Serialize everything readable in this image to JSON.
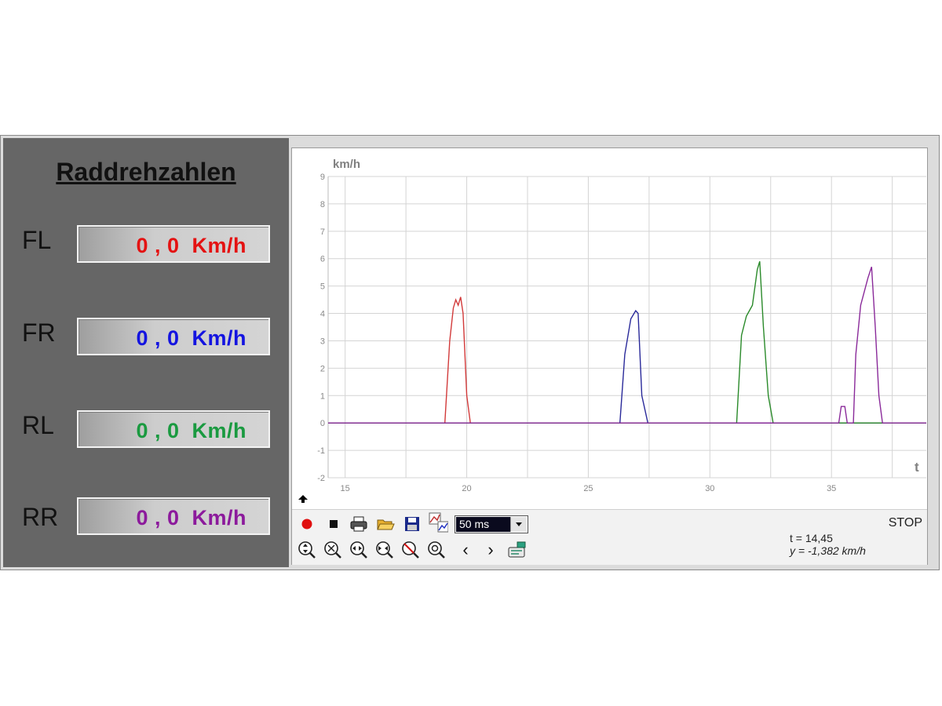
{
  "panel": {
    "title": "Raddrehzahlen",
    "wheels": [
      {
        "label": "FL",
        "value": "0 , 0",
        "unit": "Km/h",
        "color": "#e41212"
      },
      {
        "label": "FR",
        "value": "0 , 0",
        "unit": "Km/h",
        "color": "#1414e0"
      },
      {
        "label": "RL",
        "value": "0 , 0",
        "unit": "Km/h",
        "color": "#1a9a40"
      },
      {
        "label": "RR",
        "value": "0 , 0",
        "unit": "Km/h",
        "color": "#8c1a9c"
      }
    ]
  },
  "chart_data": {
    "type": "line",
    "ylabel": "km/h",
    "xlabel": "t",
    "xlim": [
      14.3,
      38.9
    ],
    "ylim": [
      -2,
      9
    ],
    "xticks": [
      15,
      20,
      25,
      30,
      35
    ],
    "yticks": [
      -2,
      -1,
      0,
      1,
      2,
      3,
      4,
      5,
      6,
      7,
      8,
      9
    ],
    "grid": true,
    "series": [
      {
        "color": "#d23a3a",
        "points": [
          [
            14.3,
            0
          ],
          [
            19.1,
            0
          ],
          [
            19.3,
            3.0
          ],
          [
            19.45,
            4.2
          ],
          [
            19.55,
            4.5
          ],
          [
            19.65,
            4.3
          ],
          [
            19.75,
            4.6
          ],
          [
            19.85,
            4.0
          ],
          [
            20.0,
            1.0
          ],
          [
            20.15,
            0
          ],
          [
            38.9,
            0
          ]
        ]
      },
      {
        "color": "#2a2a9a",
        "points": [
          [
            14.3,
            0
          ],
          [
            26.3,
            0
          ],
          [
            26.5,
            2.5
          ],
          [
            26.75,
            3.8
          ],
          [
            26.95,
            4.1
          ],
          [
            27.05,
            4.0
          ],
          [
            27.2,
            1.0
          ],
          [
            27.45,
            0
          ],
          [
            38.9,
            0
          ]
        ]
      },
      {
        "color": "#2a8a2a",
        "points": [
          [
            14.3,
            0
          ],
          [
            31.1,
            0
          ],
          [
            31.3,
            3.2
          ],
          [
            31.5,
            3.9
          ],
          [
            31.75,
            4.3
          ],
          [
            31.95,
            5.6
          ],
          [
            32.05,
            5.9
          ],
          [
            32.2,
            3.5
          ],
          [
            32.4,
            1.0
          ],
          [
            32.6,
            0
          ],
          [
            38.9,
            0
          ]
        ]
      },
      {
        "color": "#8a2a9a",
        "points": [
          [
            14.3,
            0
          ],
          [
            35.3,
            0
          ],
          [
            35.4,
            0.6
          ],
          [
            35.55,
            0.6
          ],
          [
            35.65,
            0
          ],
          [
            35.9,
            0
          ],
          [
            36.0,
            2.5
          ],
          [
            36.2,
            4.3
          ],
          [
            36.5,
            5.3
          ],
          [
            36.65,
            5.7
          ],
          [
            36.8,
            3.5
          ],
          [
            36.95,
            1.0
          ],
          [
            37.1,
            0
          ],
          [
            38.9,
            0
          ]
        ]
      }
    ]
  },
  "toolbar": {
    "interval": "50 ms",
    "status": "STOP",
    "readout_t": "t = 14,45",
    "readout_y": "y = -1,382 km/h",
    "prev_glyph": "‹",
    "next_glyph": "›",
    "icons": [
      "record-icon",
      "stop-icon",
      "print-icon",
      "open-folder-icon",
      "save-icon",
      "chart-settings-icon",
      "zoom-vertical-in-icon",
      "zoom-horizontal-in-icon",
      "zoom-horizontal-out-icon",
      "zoom-out-icon",
      "zoom-reset-icon",
      "zoom-fit-icon",
      "scroll-left-icon",
      "scroll-right-icon",
      "export-icon"
    ]
  }
}
